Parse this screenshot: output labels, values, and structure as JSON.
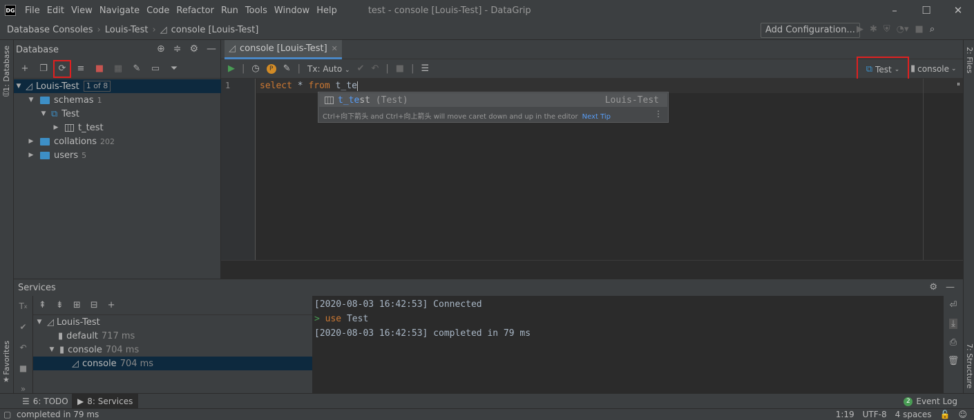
{
  "window": {
    "title": "test - console [Louis-Test] - DataGrip",
    "logo": "DG"
  },
  "menu": [
    "File",
    "Edit",
    "View",
    "Navigate",
    "Code",
    "Refactor",
    "Run",
    "Tools",
    "Window",
    "Help"
  ],
  "breadcrumb": [
    "Database Consoles",
    "Louis-Test",
    "console [Louis-Test]"
  ],
  "toolbar": {
    "add_configuration": "Add Configuration..."
  },
  "left_strip": {
    "database": "1: Database",
    "favorites": "Favorites"
  },
  "right_strip": {
    "files": "2: Files",
    "structure": "7: Structure"
  },
  "database_panel": {
    "title": "Database",
    "tree": [
      {
        "label": "Louis-Test",
        "badge": "1 of 8",
        "level": 0,
        "expanded": true,
        "selected": true
      },
      {
        "label": "schemas",
        "count": "1",
        "level": 1,
        "expanded": true
      },
      {
        "label": "Test",
        "level": 2,
        "expanded": true
      },
      {
        "label": "t_test",
        "level": 3,
        "expanded": false
      },
      {
        "label": "collations",
        "count": "202",
        "level": 1,
        "expanded": false
      },
      {
        "label": "users",
        "count": "5",
        "level": 1,
        "expanded": false
      }
    ]
  },
  "editor": {
    "tab_label": "console [Louis-Test]",
    "tx_mode": "Tx: Auto",
    "schema_selector": "Test",
    "session_selector": "console",
    "line_number": "1",
    "code": {
      "kw1": "select",
      "star": " * ",
      "kw2": "from",
      "rest": " t_te"
    },
    "completion": {
      "match": "t_te",
      "rest": "st",
      "schema": " (Test)",
      "source": "Louis-Test",
      "tip": "Ctrl+向下箭头 and Ctrl+向上箭头 will move caret down and up in the editor",
      "tip_link": "Next Tip"
    }
  },
  "services": {
    "title": "Services",
    "tree": [
      {
        "label": "Louis-Test",
        "ms": "",
        "level": 0
      },
      {
        "label": "default",
        "ms": "717 ms",
        "level": 1
      },
      {
        "label": "console",
        "ms": "704 ms",
        "level": 1
      },
      {
        "label": "console",
        "ms": "704 ms",
        "level": 2,
        "selected": true
      }
    ],
    "output": {
      "line1": "[2020-08-03 16:42:53] Connected",
      "prompt": ">",
      "use_kw": "use",
      "use_arg": "Test",
      "line3": "[2020-08-03 16:42:53] completed in 79 ms"
    }
  },
  "tool_windows": {
    "todo": "6: TODO",
    "services": "8: Services",
    "event_log": "Event Log",
    "event_count": "2"
  },
  "status": {
    "message": "completed in 79 ms",
    "position": "1:19",
    "encoding": "UTF-8",
    "indent": "4 spaces"
  }
}
